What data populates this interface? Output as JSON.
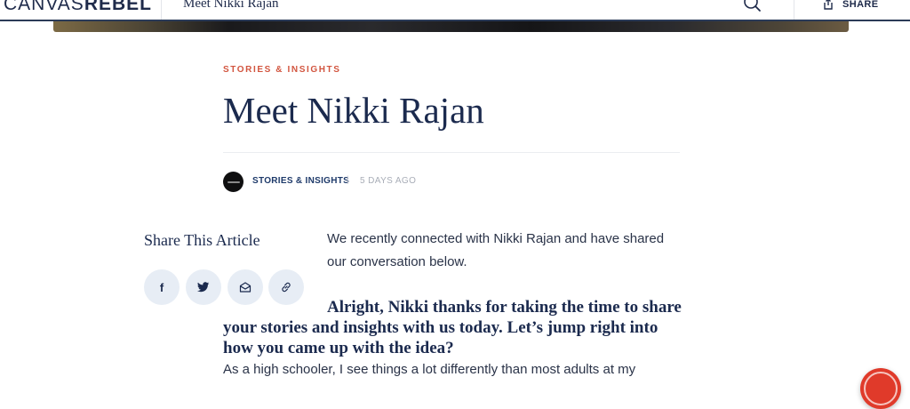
{
  "topbar": {
    "logo_light": "CANVAS",
    "logo_bold": "REBEL",
    "title": "Meet Nikki Rajan",
    "share_label": "SHARE"
  },
  "article": {
    "category": "STORIES & INSIGHTS",
    "headline": "Meet Nikki Rajan",
    "author": "STORIES & INSIGHTS",
    "date": "5 DAYS AGO",
    "intro": "We recently connected with Nikki Rajan and have shared our conversation below.",
    "question": "Alright, Nikki thanks for taking the time to share your stories and insights with us today. Let’s jump right into how you came up with the idea?",
    "answer_start": "As a high schooler, I see things a lot differently than most adults at my"
  },
  "share": {
    "heading": "Share This Article",
    "facebook_glyph": "f"
  },
  "colors": {
    "navy": "#1b2a4e",
    "accent": "#d2553f",
    "social_bg": "#e7edf5",
    "fab": "#e03a2a"
  },
  "icons": [
    "search-icon",
    "share-icon",
    "facebook-icon",
    "twitter-icon",
    "email-icon",
    "link-icon"
  ]
}
